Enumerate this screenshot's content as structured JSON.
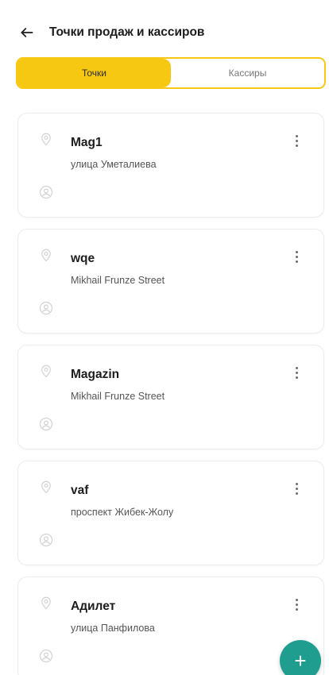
{
  "header": {
    "title": "Точки продаж и кассиров",
    "back_icon": "arrow-left-icon"
  },
  "tabs": [
    {
      "label": "Точки",
      "active": true
    },
    {
      "label": "Кассиры",
      "active": false
    }
  ],
  "points": [
    {
      "name": "Mag1",
      "address": "улица Уметалиева"
    },
    {
      "name": "wqe",
      "address": "Mikhail Frunze Street"
    },
    {
      "name": "Magazin",
      "address": "Mikhail Frunze Street"
    },
    {
      "name": "vaf",
      "address": "проспект Жибек-Жолу"
    },
    {
      "name": "Адилет",
      "address": "улица Панфилова"
    }
  ],
  "fab": {
    "label": "+"
  },
  "colors": {
    "accent": "#f7c812",
    "fab": "#1f9e8f"
  }
}
